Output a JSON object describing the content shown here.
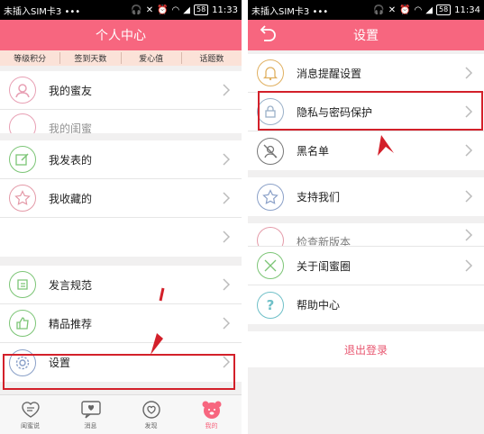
{
  "left": {
    "status": {
      "carrier": "未插入SIM卡3 •••",
      "battery": "58",
      "time": "11:33"
    },
    "title": "个人中心",
    "stats": [
      "等级积分",
      "签到天数",
      "爱心值",
      "话题数"
    ],
    "groups": [
      [
        {
          "label": "我的蜜友",
          "icon": "friends-avatar-icon"
        },
        {
          "label": "我的闺蜜",
          "icon": "bestie-avatar-icon"
        }
      ],
      [
        {
          "label": "我发表的",
          "icon": "edit-post-icon"
        },
        {
          "label": "我收藏的",
          "icon": "star-icon"
        },
        {
          "label": "",
          "icon": ""
        }
      ],
      [
        {
          "label": "发言规范",
          "icon": "rules-icon"
        },
        {
          "label": "精品推荐",
          "icon": "thumbs-up-icon"
        },
        {
          "label": "设置",
          "icon": "gear-icon"
        }
      ]
    ],
    "tabs": [
      {
        "label": "闺蜜说",
        "icon": "chat-heart-icon"
      },
      {
        "label": "消息",
        "icon": "message-heart-icon"
      },
      {
        "label": "发现",
        "icon": "discover-icon"
      },
      {
        "label": "我的",
        "icon": "bear-icon"
      }
    ]
  },
  "right": {
    "status": {
      "carrier": "未插入SIM卡3 •••",
      "battery": "58",
      "time": "11:34"
    },
    "title": "设置",
    "groups": [
      [
        {
          "label": "消息提醒设置",
          "icon": "bell-icon"
        },
        {
          "label": "隐私与密码保护",
          "icon": "privacy-lock-icon"
        },
        {
          "label": "黑名单",
          "icon": "blocked-user-icon"
        }
      ],
      [
        {
          "label": "支持我们",
          "icon": "rate-star-icon"
        }
      ],
      [
        {
          "label": "检查新版本",
          "icon": "update-icon"
        },
        {
          "label": "关于闺蜜圈",
          "icon": "about-icon"
        },
        {
          "label": "帮助中心",
          "icon": "help-icon"
        }
      ]
    ],
    "logout": "退出登录"
  },
  "colors": {
    "accent": "#f7667f",
    "highlight": "#d3202a",
    "stats_bg": "#fbe2d8"
  }
}
